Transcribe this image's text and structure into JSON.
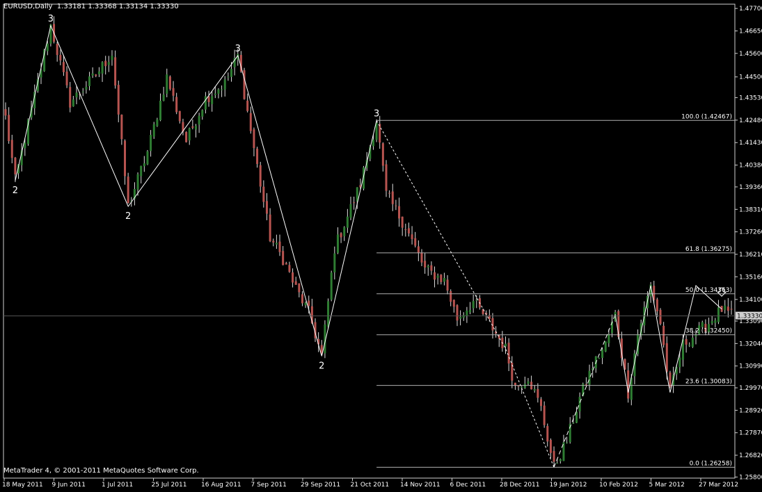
{
  "header": {
    "symbol": "EURUSD,Daily",
    "ohlc": "1.33181 1.33368 1.33134 1.33330"
  },
  "footer": {
    "copyright": "MetaTrader 4, © 2001-2011 MetaQuotes Software Corp."
  },
  "colors": {
    "background": "#000000",
    "up_candle": "#2e7d32",
    "down_candle": "#b85450",
    "wick": "#dddddd",
    "lines": "#ffffff",
    "axis_text": "#ffffff",
    "fib_line": "#b0b0b0",
    "current_price_box": "#d0d0d0"
  },
  "chart_data": {
    "type": "candlestick",
    "y_axis_ticks": [
      1.477,
      1.4665,
      1.456,
      1.445,
      1.4353,
      1.4248,
      1.4143,
      1.4038,
      1.3936,
      1.3831,
      1.3726,
      1.3621,
      1.3516,
      1.341,
      1.3309,
      1.3204,
      1.3099,
      1.2997,
      1.2892,
      1.2787,
      1.2682,
      1.258
    ],
    "y_axis_labels": [
      "1.47700",
      "1.46650",
      "1.45600",
      "1.44500",
      "1.43530",
      "1.42480",
      "1.41430",
      "1.40380",
      "1.39360",
      "1.38310",
      "1.37260",
      "1.36210",
      "1.35160",
      "1.34100",
      "1.33090",
      "1.32040",
      "1.30990",
      "1.29970",
      "1.28920",
      "1.27870",
      "1.26820",
      "1.25800"
    ],
    "ylim": [
      1.258,
      1.479
    ],
    "current_price": "1.33330",
    "x_axis_labels": [
      "18 May 2011",
      "9 Jun 2011",
      "1 Jul 2011",
      "25 Jul 2011",
      "16 Aug 2011",
      "7 Sep 2011",
      "29 Sep 2011",
      "21 Oct 2011",
      "14 Nov 2011",
      "6 Dec 2011",
      "28 Dec 2011",
      "19 Jan 2012",
      "10 Feb 2012",
      "5 Mar 2012",
      "27 Mar 2012"
    ],
    "fibonacci_levels": [
      {
        "label": "100.0 (1.42467)",
        "price": 1.42467
      },
      {
        "label": "61.8 (1.36275)",
        "price": 1.36275
      },
      {
        "label": "50.0 (1.34363)",
        "price": 1.34363
      },
      {
        "label": "38.2 (1.32450)",
        "price": 1.3245
      },
      {
        "label": "23.6 (1.30083)",
        "price": 1.30083
      },
      {
        "label": "0.0 (1.26258)",
        "price": 1.26258
      }
    ],
    "wave_labels": [
      {
        "text": "2",
        "bar": 3,
        "price": 1.3965,
        "position": "below"
      },
      {
        "text": "3",
        "bar": 14,
        "price": 1.469,
        "position": "above"
      },
      {
        "text": "2",
        "bar": 38,
        "price": 1.3845,
        "position": "below"
      },
      {
        "text": "3",
        "bar": 72,
        "price": 1.455,
        "position": "above"
      },
      {
        "text": "2",
        "bar": 98,
        "price": 1.3145,
        "position": "below"
      },
      {
        "text": "3",
        "bar": 115,
        "price": 1.4246,
        "position": "above"
      }
    ],
    "arrow_marker": {
      "bar": 222,
      "price": 1.3425
    },
    "zigzag_solid": [
      [
        3,
        1.3965
      ],
      [
        14,
        1.469
      ],
      [
        38,
        1.3845
      ],
      [
        72,
        1.455
      ],
      [
        98,
        1.3145
      ],
      [
        115,
        1.4246
      ]
    ],
    "zigzag_dashed_down": [
      [
        115,
        1.4246
      ],
      [
        155,
        1.318
      ],
      [
        170,
        1.2626
      ]
    ],
    "zigzag_dashed_up": [
      [
        170,
        1.2626
      ],
      [
        189,
        1.334
      ]
    ],
    "zigzag_solid_tail": [
      [
        189,
        1.334
      ],
      [
        193,
        1.2975
      ],
      [
        200,
        1.3475
      ],
      [
        206,
        1.2975
      ],
      [
        214,
        1.3475
      ],
      [
        222,
        1.3365
      ]
    ],
    "anchors": [
      [
        0,
        1.426
      ],
      [
        3,
        1.3965
      ],
      [
        14,
        1.469
      ],
      [
        20,
        1.433
      ],
      [
        28,
        1.446
      ],
      [
        33,
        1.456
      ],
      [
        38,
        1.3845
      ],
      [
        44,
        1.41
      ],
      [
        50,
        1.445
      ],
      [
        56,
        1.415
      ],
      [
        62,
        1.435
      ],
      [
        68,
        1.442
      ],
      [
        72,
        1.455
      ],
      [
        76,
        1.42
      ],
      [
        82,
        1.37
      ],
      [
        86,
        1.36
      ],
      [
        90,
        1.346
      ],
      [
        94,
        1.335
      ],
      [
        98,
        1.3145
      ],
      [
        102,
        1.365
      ],
      [
        106,
        1.38
      ],
      [
        110,
        1.395
      ],
      [
        115,
        1.4246
      ],
      [
        118,
        1.39
      ],
      [
        124,
        1.375
      ],
      [
        130,
        1.355
      ],
      [
        136,
        1.35
      ],
      [
        140,
        1.332
      ],
      [
        145,
        1.34
      ],
      [
        150,
        1.33
      ],
      [
        155,
        1.318
      ],
      [
        158,
        1.3
      ],
      [
        162,
        1.305
      ],
      [
        166,
        1.29
      ],
      [
        170,
        1.2626
      ],
      [
        174,
        1.275
      ],
      [
        178,
        1.295
      ],
      [
        182,
        1.31
      ],
      [
        186,
        1.32
      ],
      [
        189,
        1.334
      ],
      [
        193,
        1.2975
      ],
      [
        196,
        1.325
      ],
      [
        200,
        1.3475
      ],
      [
        203,
        1.33
      ],
      [
        206,
        1.2975
      ],
      [
        210,
        1.32
      ],
      [
        214,
        1.325
      ],
      [
        218,
        1.33
      ],
      [
        222,
        1.3365
      ],
      [
        225,
        1.3333
      ]
    ],
    "bar_count": 226
  }
}
